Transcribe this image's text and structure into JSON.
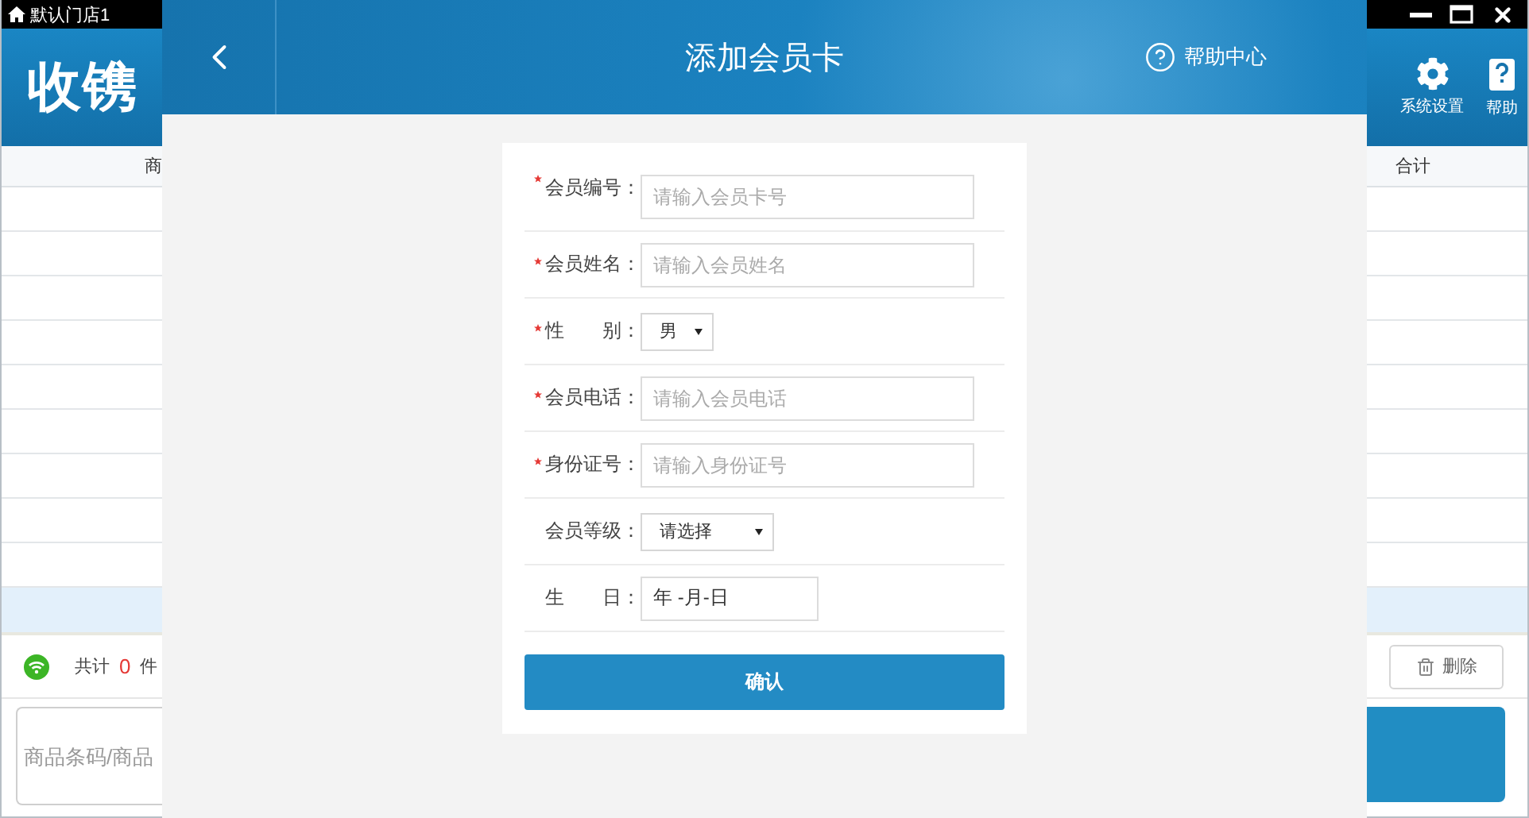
{
  "title_bar": {
    "store": "默认门店1"
  },
  "header": {
    "logo": "收镌",
    "tools": [
      {
        "kind": "settings",
        "label": "系统设置"
      },
      {
        "kind": "help",
        "label": "帮助"
      }
    ]
  },
  "table": {
    "columns": [
      "商",
      "合计"
    ]
  },
  "summary": {
    "prefix": "共计",
    "count": "0",
    "suffix": "件"
  },
  "delete_button": "删除",
  "barcode_field": {
    "placeholder": "商品条码/商品"
  },
  "dialog": {
    "title": "添加会员卡",
    "help": "帮助中心",
    "confirm": "确认",
    "fields": [
      {
        "label": "会员编号：",
        "required": true,
        "kind": "text",
        "placeholder": "请输入会员卡号"
      },
      {
        "label": "会员姓名：",
        "required": true,
        "kind": "text",
        "placeholder": "请输入会员姓名"
      },
      {
        "label": "性　　别：",
        "required": true,
        "kind": "select",
        "value": "男"
      },
      {
        "label": "会员电话：",
        "required": true,
        "kind": "text",
        "placeholder": "请输入会员电话"
      },
      {
        "label": "身份证号：",
        "required": true,
        "kind": "text",
        "placeholder": "请输入身份证号"
      },
      {
        "label": "会员等级：",
        "required": false,
        "kind": "select",
        "value": "请选择"
      },
      {
        "label": "生　　日：",
        "required": false,
        "kind": "date",
        "value": "年 -月-日"
      }
    ]
  }
}
